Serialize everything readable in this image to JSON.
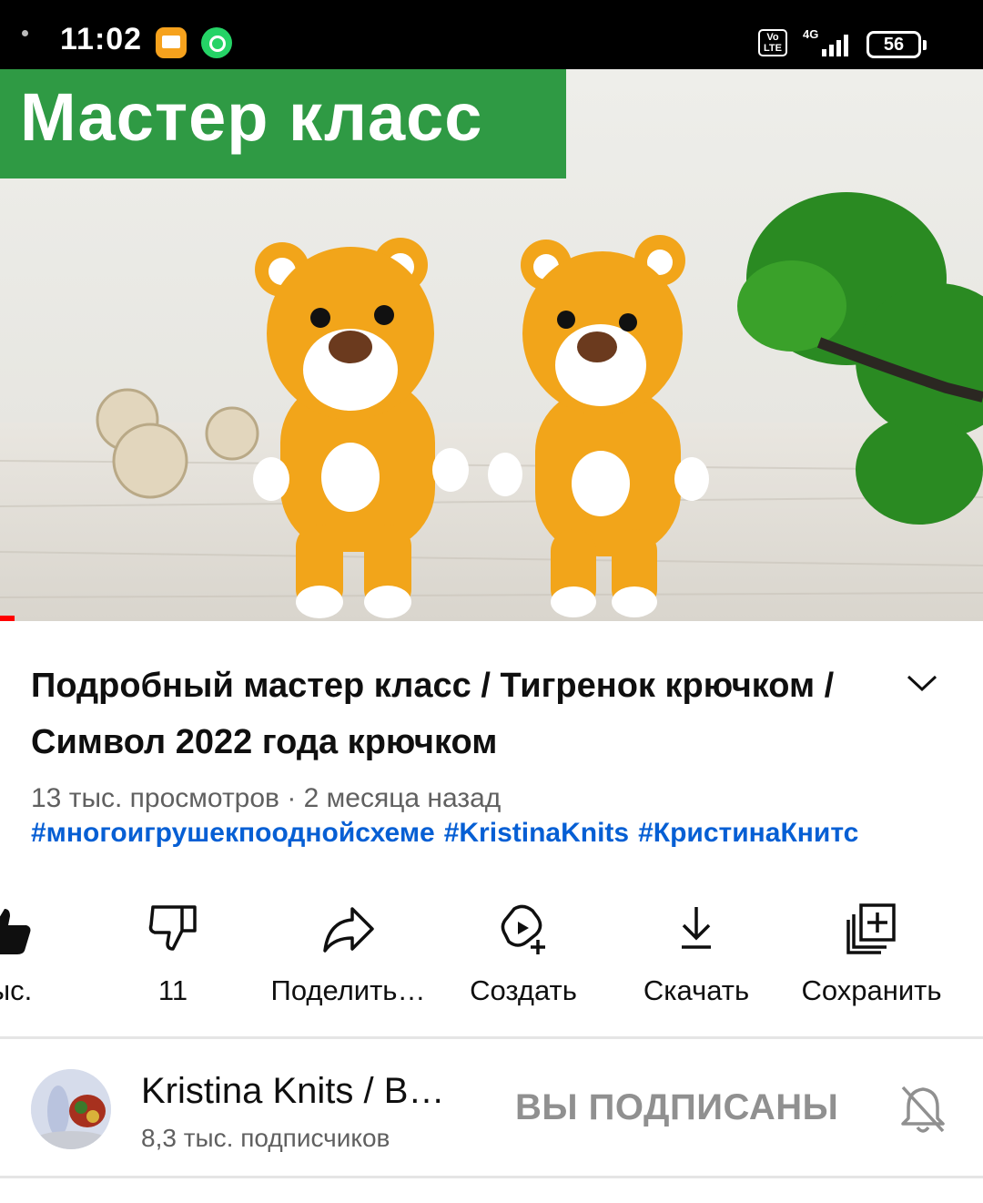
{
  "status_bar": {
    "time": "11:02",
    "network": "4G",
    "volte": "Vo\nLTE",
    "battery": "56",
    "icons": [
      "mail-icon",
      "whatsapp-icon",
      "volte-icon",
      "signal-icon",
      "battery-icon"
    ]
  },
  "video": {
    "overlay_text": "Мастер класс",
    "progress": 0.015,
    "colors": {
      "banner": "#2f9a44",
      "tiger": "#f2a51a",
      "plant": "#1f7a1f",
      "progress": "#ff0000"
    }
  },
  "title": "Подробный мастер класс / Тигренок крючком / Символ 2022 года крючком",
  "meta": "13 тыс. просмотров · 2 месяца назад",
  "hashtags": [
    "#многоигрушекпоодной схеме",
    "#KristinaKnits",
    "#КристинаКнитс"
  ],
  "actions": {
    "like": "тыс.",
    "dislike": "11",
    "share": "Поделить…",
    "create": "Создать",
    "download": "Скачать",
    "save": "Сохранить"
  },
  "channel": {
    "name": "Kristina Knits / В…",
    "subscribers": "8,3 тыс. подписчиков",
    "subscribe_state": "ВЫ ПОДПИСАНЫ"
  }
}
